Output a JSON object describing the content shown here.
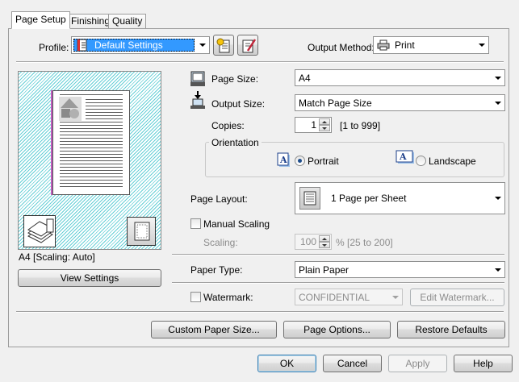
{
  "tabs": [
    {
      "label": "Page Setup",
      "active": true
    },
    {
      "label": "Finishing",
      "active": false
    },
    {
      "label": "Quality",
      "active": false
    }
  ],
  "profile": {
    "label": "Profile:",
    "value": "Default Settings"
  },
  "output_method": {
    "label": "Output Method:",
    "value": "Print"
  },
  "page_size": {
    "label": "Page Size:",
    "value": "A4"
  },
  "output_size": {
    "label": "Output Size:",
    "value": "Match Page Size"
  },
  "copies": {
    "label": "Copies:",
    "value": "1",
    "range": "[1 to 999]"
  },
  "orientation": {
    "label": "Orientation",
    "portrait": "Portrait",
    "landscape": "Landscape",
    "selected": "Portrait"
  },
  "page_layout": {
    "label": "Page Layout:",
    "value": "1 Page per Sheet"
  },
  "manual_scaling": {
    "label": "Manual Scaling",
    "checked": false
  },
  "scaling": {
    "label": "Scaling:",
    "value": "100",
    "range": "% [25 to 200]"
  },
  "preview": {
    "caption": "A4 [Scaling: Auto]",
    "view_settings": "View Settings"
  },
  "paper_type": {
    "label": "Paper Type:",
    "value": "Plain Paper"
  },
  "watermark": {
    "label": "Watermark:",
    "checked": false,
    "value": "CONFIDENTIAL",
    "edit_button": "Edit Watermark..."
  },
  "panel_buttons": {
    "custom_paper_size": "Custom Paper Size...",
    "page_options": "Page Options...",
    "restore_defaults": "Restore Defaults"
  },
  "dialog_buttons": {
    "ok": "OK",
    "cancel": "Cancel",
    "apply": "Apply",
    "help": "Help"
  },
  "icons": {
    "profile_icon": "profile-list-icon",
    "add_profile": "add-profile-icon",
    "edit_profile": "edit-profile-icon",
    "printer": "printer-icon",
    "page_size_icon": "page-size-icon",
    "output_size_icon": "output-size-icon",
    "portrait_icon": "portrait-a-icon",
    "landscape_icon": "landscape-a-icon",
    "layout_icon": "one-page-layout-icon"
  },
  "colors": {
    "selection": "#3399ff",
    "preview_stripe": "#66cfd6",
    "page_edge": "#c05bbd"
  }
}
